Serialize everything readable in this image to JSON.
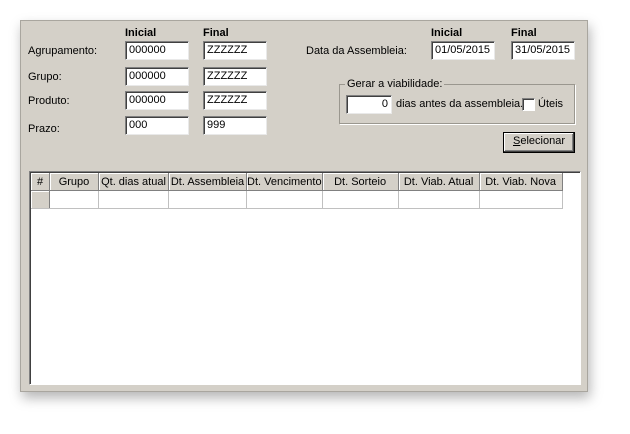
{
  "headers": {
    "inicial": "Inicial",
    "final": "Final",
    "data_inicial": "Inicial",
    "data_final": "Final"
  },
  "fields": {
    "agrupamento": {
      "label": "Agrupamento:",
      "inicial": "000000",
      "final": "ZZZZZZ"
    },
    "grupo": {
      "label": "Grupo:",
      "inicial": "000000",
      "final": "ZZZZZZ"
    },
    "produto": {
      "label": "Produto:",
      "inicial": "000000",
      "final": "ZZZZZZ"
    },
    "prazo": {
      "label": "Prazo:",
      "inicial": "000",
      "final": "999"
    }
  },
  "data_assembleia": {
    "label": "Data da Assembleia:",
    "inicial": "01/05/2015",
    "final": "31/05/2015"
  },
  "viabilidade": {
    "title": "Gerar a viabilidade:",
    "dias": "0",
    "suffix": "dias antes da assembleia.",
    "uteis_label": "Úteis",
    "uteis_checked": false
  },
  "selecionar_button": {
    "label": "Selecionar",
    "mnemonic": "S",
    "rest": "elecionar"
  },
  "grid": {
    "columns": [
      "#",
      "Grupo",
      "Qt. dias atual",
      "Dt. Assembleia",
      "Dt. Vencimento",
      "Dt. Sorteio",
      "Dt. Viab. Atual",
      "Dt. Viab. Nova"
    ],
    "rows": []
  }
}
